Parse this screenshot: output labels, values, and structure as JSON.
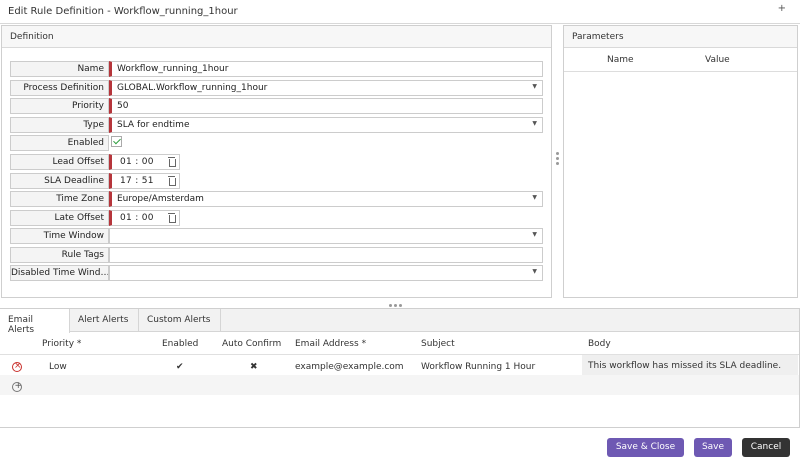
{
  "dialog": {
    "title": "Edit Rule Definition - Workflow_running_1hour",
    "plus": "+"
  },
  "definition": {
    "header": "Definition",
    "fields": {
      "name": {
        "label": "Name",
        "value": "Workflow_running_1hour"
      },
      "process_definition": {
        "label": "Process Definition",
        "value": "GLOBAL.Workflow_running_1hour"
      },
      "priority": {
        "label": "Priority",
        "value": "50"
      },
      "type": {
        "label": "Type",
        "value": "SLA for endtime"
      },
      "enabled": {
        "label": "Enabled",
        "checked": true
      },
      "lead_offset": {
        "label": "Lead Offset",
        "value": "01 : 00"
      },
      "sla_deadline": {
        "label": "SLA Deadline",
        "value": "17 : 51"
      },
      "time_zone": {
        "label": "Time Zone",
        "value": "Europe/Amsterdam"
      },
      "late_offset": {
        "label": "Late Offset",
        "value": "01 : 00"
      },
      "time_window": {
        "label": "Time Window",
        "value": ""
      },
      "rule_tags": {
        "label": "Rule Tags",
        "value": ""
      },
      "disabled_time_window": {
        "label": "Disabled Time Wind…",
        "value": ""
      }
    }
  },
  "parameters": {
    "header": "Parameters",
    "columns": [
      "Name",
      "Value"
    ]
  },
  "alerts": {
    "tabs": [
      "Email Alerts",
      "Alert Alerts",
      "Custom Alerts"
    ],
    "active_tab": "Email Alerts",
    "columns": [
      "Priority",
      "Enabled",
      "Auto Confirm",
      "Email Address",
      "Subject",
      "Body"
    ],
    "rows": [
      {
        "priority": "Low",
        "enabled": "✔",
        "auto_confirm": "✖",
        "email": "example@example.com",
        "subject": "Workflow Running 1 Hour",
        "body": "This workflow has missed its SLA deadline."
      }
    ]
  },
  "footer": {
    "save_close": "Save & Close",
    "save": "Save",
    "cancel": "Cancel"
  },
  "colors": {
    "primary": "#6e59b3",
    "required": "#b6353b",
    "cancel": "#333333"
  }
}
